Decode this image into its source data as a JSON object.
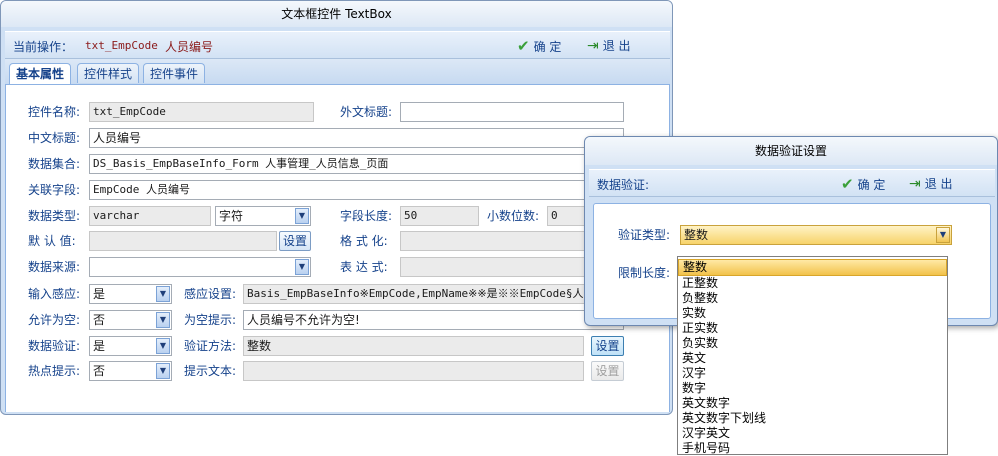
{
  "main": {
    "title": "文本框控件  TextBox",
    "toolbar": {
      "op_label": "当前操作：",
      "op_control": "txt_EmpCode",
      "op_name": "人员编号",
      "confirm": "确 定",
      "exit": "退 出"
    },
    "tabs": [
      "基本属性",
      "控件样式",
      "控件事件"
    ],
    "form": {
      "control_name_label": "控件名称:",
      "control_name": "txt_EmpCode",
      "foreign_title_label": "外文标题:",
      "foreign_title": "",
      "cn_title_label": "中文标题:",
      "cn_title": "人员编号",
      "dataset_label": "数据集合:",
      "dataset": "DS_Basis_EmpBaseInfo_Form  人事管理_人员信息_页面",
      "field_label": "关联字段:",
      "field": "EmpCode  人员编号",
      "datatype_label": "数据类型:",
      "datatype": "varchar",
      "datatype_cn": "字符",
      "length_label": "字段长度:",
      "length": "50",
      "decimals_label": "小数位数:",
      "decimals": "0",
      "default_label": "默 认 值:",
      "default_value": "",
      "default_btn": "设置",
      "format_label": "格 式 化:",
      "format_value": "",
      "source_label": "数据来源:",
      "source_value": "",
      "expr_label": "表 达 式:",
      "expr_value": "",
      "input_sense_label": "输入感应:",
      "input_sense": "是",
      "sense_setting_label": "感应设置:",
      "sense_setting": "Basis_EmpBaseInfo※EmpCode,EmpName※※是※※EmpCode§人员",
      "allow_empty_label": "允许为空:",
      "allow_empty": "否",
      "empty_hint_label": "为空提示:",
      "empty_hint": "人员编号不允许为空!",
      "validate_label": "数据验证:",
      "validate": "是",
      "validate_method_label": "验证方法:",
      "validate_method": "整数",
      "validate_btn": "设置",
      "hotspot_label": "热点提示:",
      "hotspot": "否",
      "hint_text_label": "提示文本:",
      "hint_text": "",
      "hint_btn": "设置"
    }
  },
  "dialog": {
    "title": "数据验证设置",
    "toolbar_label": "数据验证:",
    "confirm": "确 定",
    "exit": "退 出",
    "type_label": "验证类型:",
    "type_value": "整数",
    "limit_label": "限制长度:",
    "options": [
      "整数",
      "正整数",
      "负整数",
      "实数",
      "正实数",
      "负实数",
      "英文",
      "汉字",
      "数字",
      "英文数字",
      "英文数字下划线",
      "汉字英文",
      "手机号码"
    ],
    "selected_index": 0
  }
}
